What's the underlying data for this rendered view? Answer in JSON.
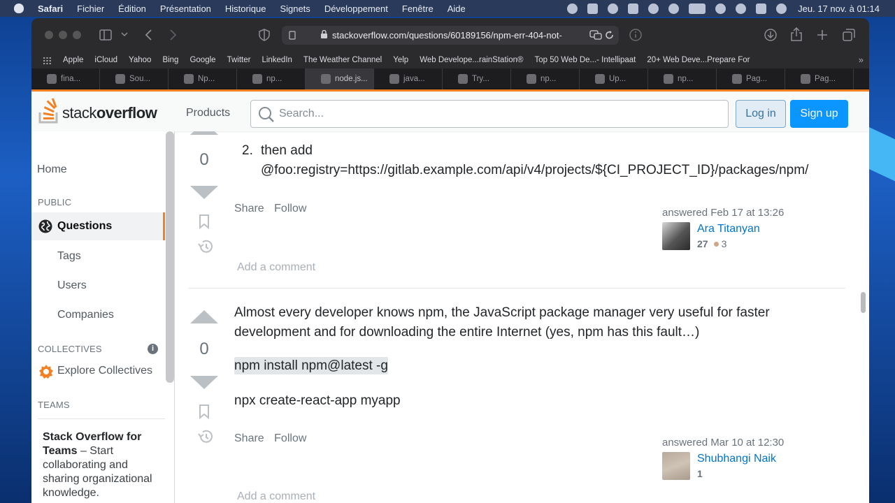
{
  "menubar": {
    "app": "Safari",
    "items": [
      "Fichier",
      "Édition",
      "Présentation",
      "Historique",
      "Signets",
      "Développement",
      "Fenêtre",
      "Aide"
    ],
    "clock": "Jeu. 17 nov. à  01:14"
  },
  "browser": {
    "url": "stackoverflow.com/questions/60189156/npm-err-404-not-",
    "bookmarks": [
      "Apple",
      "iCloud",
      "Yahoo",
      "Bing",
      "Google",
      "Twitter",
      "LinkedIn",
      "The Weather Channel",
      "Yelp",
      "Web Develope...rainStation®",
      "Top 50 Web De...- Intellipaat",
      "20+ Web Deve...Prepare For"
    ],
    "bookmarks_more": "»",
    "tabs": [
      "fina...",
      "Sou...",
      "Np...",
      "np...",
      "node.js...",
      "java...",
      "Try...",
      "np...",
      "Up...",
      "np...",
      "Pag...",
      "Pag..."
    ],
    "active_tab_index": 4
  },
  "so": {
    "logo_plain": "stack",
    "logo_bold": "overflow",
    "products": "Products",
    "search_placeholder": "Search...",
    "login": "Log in",
    "signup": "Sign up"
  },
  "leftnav": {
    "home": "Home",
    "public": "PUBLIC",
    "questions": "Questions",
    "tags": "Tags",
    "users": "Users",
    "companies": "Companies",
    "collectives": "COLLECTIVES",
    "info": "i",
    "explore": "Explore Collectives",
    "teams": "TEAMS",
    "teams_title": "Stack Overflow for Teams",
    "teams_text": " – Start collaborating and sharing organizational knowledge."
  },
  "answer1": {
    "votes": "0",
    "list_num": "2.",
    "line1": "then add",
    "line2": "@foo:registry=https://gitlab.example.com/api/v4/projects/${CI_PROJECT_ID}/packages/npm/",
    "share": "Share",
    "follow": "Follow",
    "answered": "answered Feb 17 at 13:26",
    "author": "Ara Titanyan",
    "rep": "27",
    "bronze": "3",
    "add_comment": "Add a comment"
  },
  "answer2": {
    "votes": "0",
    "p1": "Almost every developer knows npm, the JavaScript package manager very useful for faster development and for downloading the entire Internet (yes, npm has this fault…)",
    "code1": "npm install npm@latest -g",
    "p2": "npx create-react-app myapp",
    "share": "Share",
    "follow": "Follow",
    "answered": "answered Mar 10 at 12:30",
    "author": "Shubhangi Naik",
    "rep": "1",
    "add_comment": "Add a comment"
  }
}
